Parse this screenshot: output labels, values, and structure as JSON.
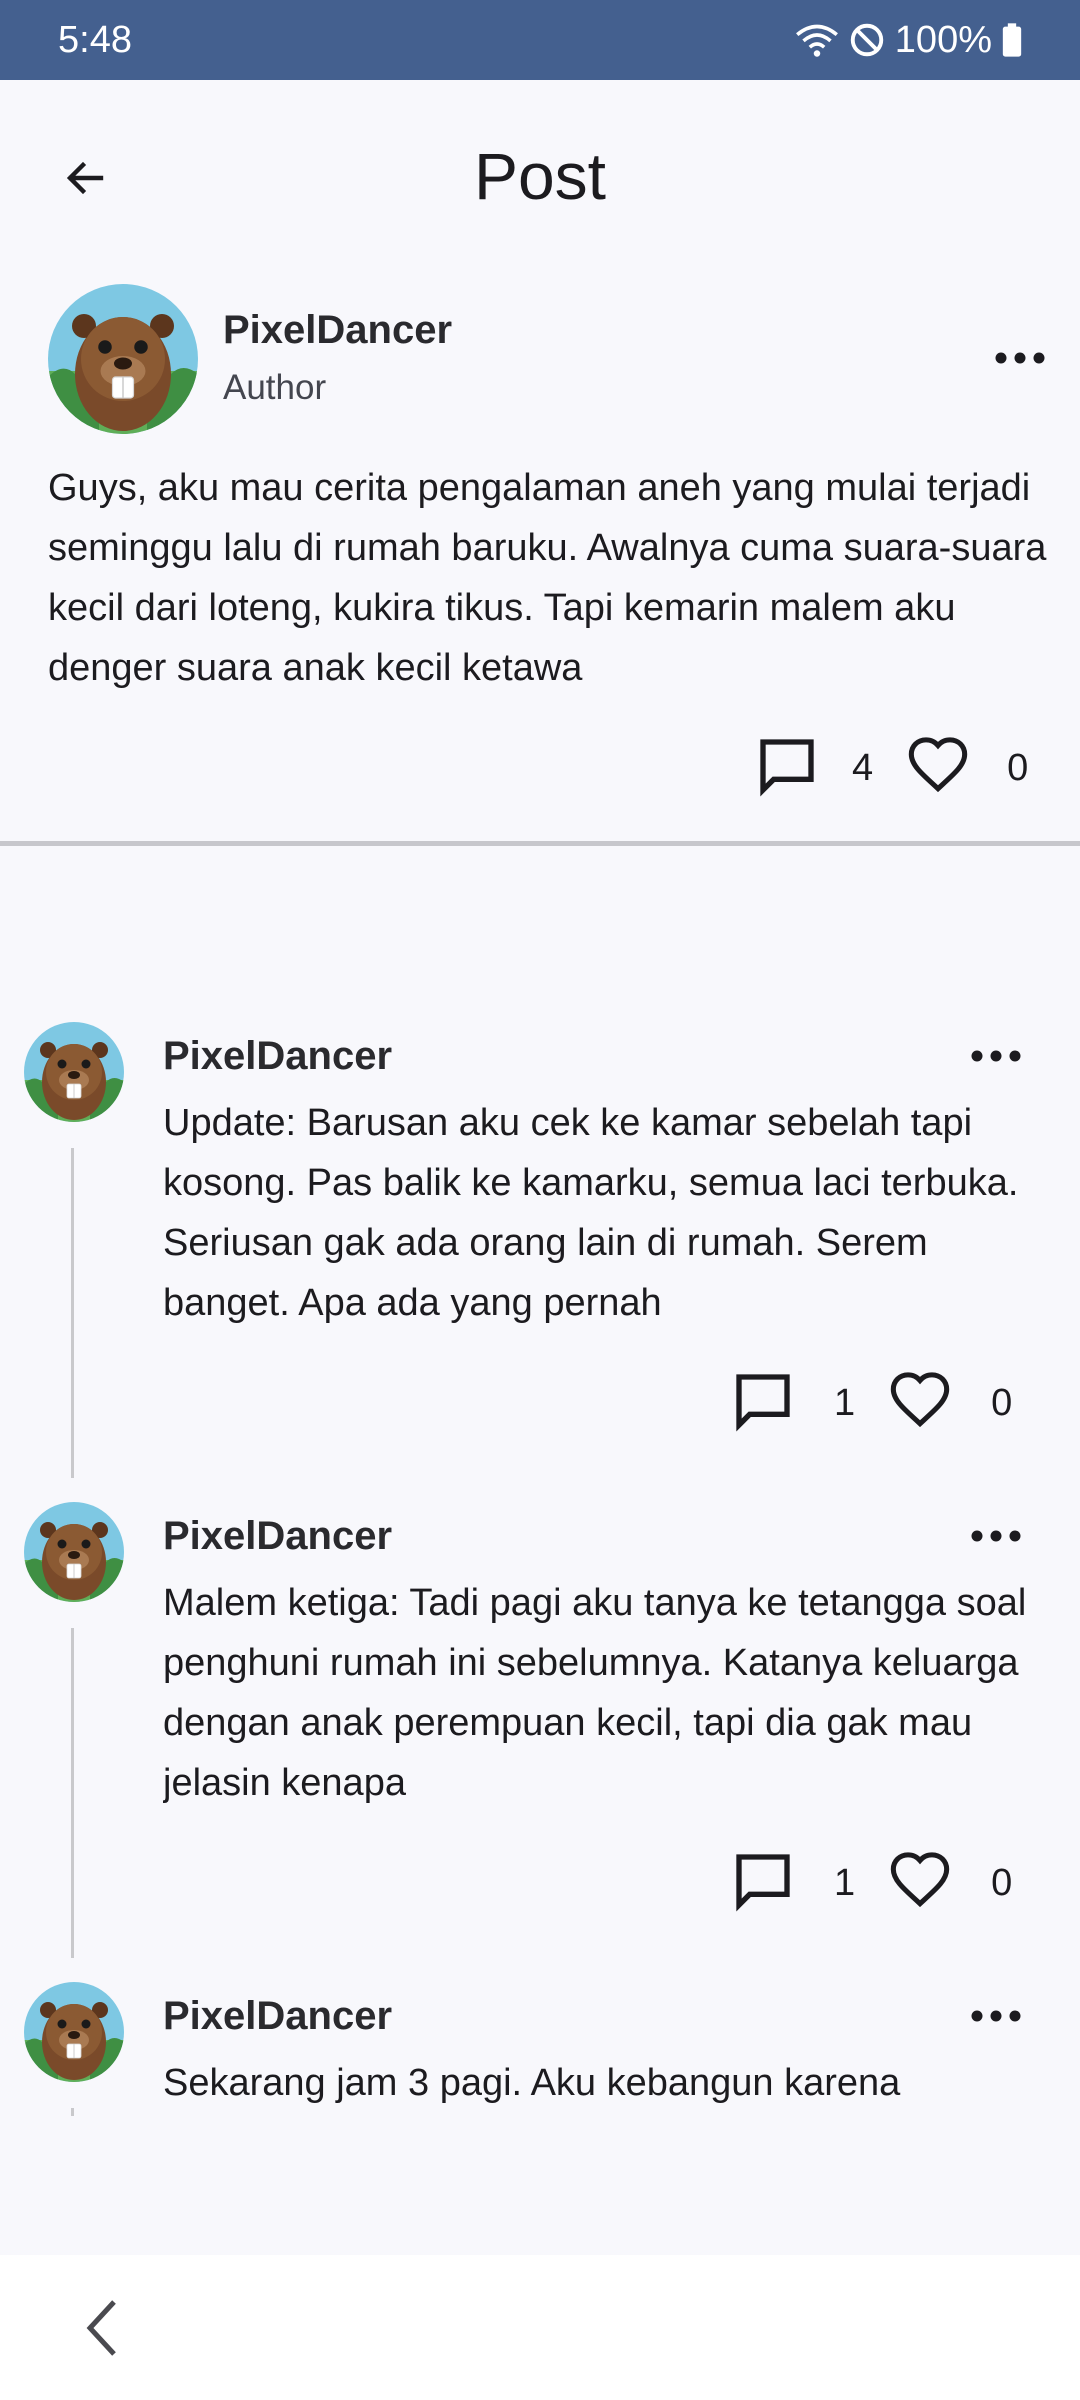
{
  "status_bar": {
    "time": "5:48",
    "battery": "100%"
  },
  "header": {
    "title": "Post"
  },
  "post": {
    "author": "PixelDancer",
    "role": "Author",
    "body": "Guys, aku mau cerita pengalaman aneh yang mulai terjadi seminggu lalu di rumah baruku. Awalnya cuma suara-suara kecil dari loteng, kukira tikus. Tapi kemarin malem aku denger suara anak kecil ketawa",
    "comment_count": "4",
    "like_count": "0"
  },
  "comments": [
    {
      "author": "PixelDancer",
      "body": "Update: Barusan aku cek ke kamar sebelah tapi kosong. Pas balik ke kamarku, semua laci terbuka. Seriusan gak ada orang lain di rumah. Serem banget. Apa ada yang pernah",
      "reply_count": "1",
      "like_count": "0"
    },
    {
      "author": "PixelDancer",
      "body": "Malem ketiga: Tadi pagi aku tanya ke tetangga soal penghuni rumah ini sebelumnya. Katanya keluarga dengan anak perempuan kecil, tapi dia gak mau jelasin kenapa",
      "reply_count": "1",
      "like_count": "0"
    },
    {
      "author": "PixelDancer",
      "body": "Sekarang jam 3 pagi. Aku kebangun karena"
    }
  ],
  "icons": {
    "back": "arrow-left-icon",
    "more": "more-horiz-icon",
    "comment": "chat-bubble-outline-icon",
    "like": "heart-outline-icon",
    "avatar": "beaver-avatar",
    "nav_back": "chevron-left-icon"
  },
  "colors": {
    "status_bar": "#44608f",
    "background": "#f8f8fc",
    "divider": "#c7c7cc"
  }
}
